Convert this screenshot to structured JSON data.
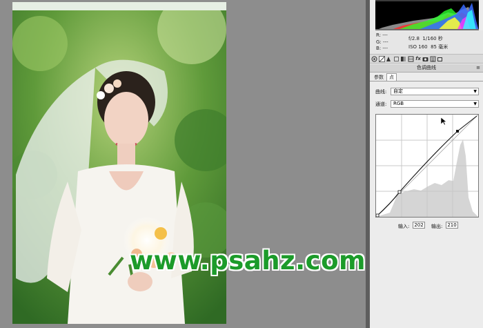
{
  "histogram": {
    "colors": [
      "#ff2a2a",
      "#2aff2a",
      "#3a6bff",
      "#ffff33",
      "#ff33ff",
      "#33ffff"
    ]
  },
  "info": {
    "r_label": "R:",
    "r_value": "---",
    "g_label": "G:",
    "g_value": "---",
    "b_label": "B:",
    "b_value": "---",
    "aperture": "f/2.8",
    "shutter": "1/160 秒",
    "iso": "ISO 160",
    "focal": "85 毫米"
  },
  "tools": [
    "basic-icon",
    "tone-curve-icon",
    "detail-icon",
    "hsl-icon",
    "split-toning-icon",
    "lens-icon",
    "fx-icon",
    "camera-calibration-icon",
    "presets-icon",
    "snapshots-icon"
  ],
  "panel": {
    "title": "色调曲线",
    "menu_icon": "≡",
    "tab_parametric": "参数",
    "tab_point": "点",
    "curve_label": "曲线:",
    "curve_value": "自定",
    "channel_label": "通道:",
    "channel_value": "RGB",
    "input_label": "输入:",
    "input_value": "202",
    "output_label": "输出:",
    "output_value": "210"
  },
  "watermark": "www.psahz.com"
}
